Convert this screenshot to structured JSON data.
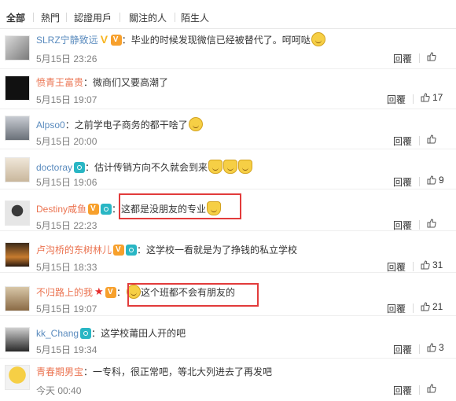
{
  "tabs": [
    "全部",
    "熱門",
    "認證用戶",
    "關注的人",
    "陌生人"
  ],
  "reply_label": "回覆",
  "comments": [
    {
      "user": "SLRZ宁静致远",
      "sep": "：",
      "text": "毕业的时候发现微信已经被替代了。呵呵哒",
      "time": "5月15日 23:26",
      "likes": ""
    },
    {
      "user": "愤青王富贵",
      "sep": "：",
      "text": "微商们又要高潮了",
      "time": "5月15日 19:07",
      "likes": "17"
    },
    {
      "user": "Alpso0",
      "sep": "：",
      "text": "之前学电子商务的都干啥了",
      "time": "5月15日 20:00",
      "likes": ""
    },
    {
      "user": "doctoray",
      "sep": "：",
      "text": "估计传销方向不久就会到来",
      "time": "5月15日 19:06",
      "likes": "9"
    },
    {
      "user": "Destiny咸鱼",
      "sep": "：",
      "text": "这都是没朋友的专业",
      "time": "5月15日 22:23",
      "likes": ""
    },
    {
      "user": "卢沟桥的东树林儿",
      "sep": "：",
      "text": "这学校一看就是为了挣钱的私立学校",
      "time": "5月15日 18:33",
      "likes": "31"
    },
    {
      "user": "不归路上的我",
      "sep": "：",
      "text": "这个班都不会有朋友的",
      "time": "5月15日 19:07",
      "likes": "21"
    },
    {
      "user": "kk_Chang",
      "sep": "：",
      "text": "这学校莆田人开的吧",
      "time": "5月15日 19:34",
      "likes": "3"
    },
    {
      "user": "青春期男宝",
      "sep": "：",
      "text": "一专科，很正常吧，等北大列进去了再发吧",
      "time": "今天 00:40",
      "likes": ""
    }
  ],
  "colors": {
    "username": "#eb7350",
    "highlight": "#e23b3b",
    "meta": "#808080"
  }
}
